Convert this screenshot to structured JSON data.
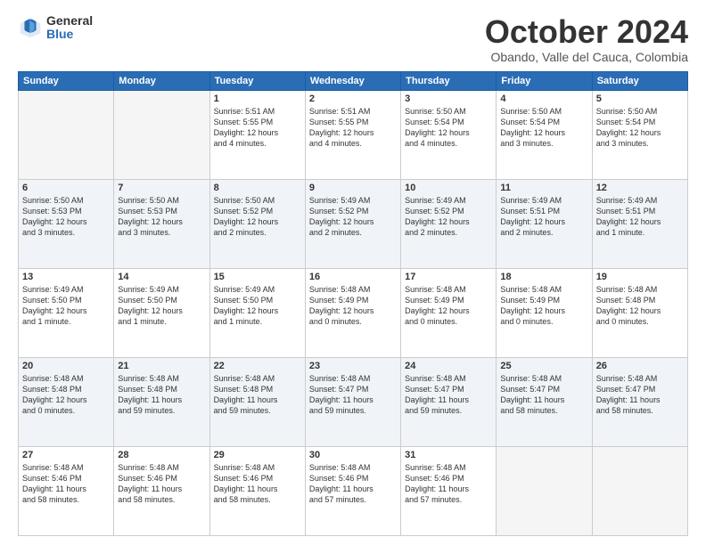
{
  "logo": {
    "general": "General",
    "blue": "Blue"
  },
  "header": {
    "month": "October 2024",
    "location": "Obando, Valle del Cauca, Colombia"
  },
  "days_of_week": [
    "Sunday",
    "Monday",
    "Tuesday",
    "Wednesday",
    "Thursday",
    "Friday",
    "Saturday"
  ],
  "weeks": [
    [
      {
        "day": "",
        "info": ""
      },
      {
        "day": "",
        "info": ""
      },
      {
        "day": "1",
        "info": "Sunrise: 5:51 AM\nSunset: 5:55 PM\nDaylight: 12 hours\nand 4 minutes."
      },
      {
        "day": "2",
        "info": "Sunrise: 5:51 AM\nSunset: 5:55 PM\nDaylight: 12 hours\nand 4 minutes."
      },
      {
        "day": "3",
        "info": "Sunrise: 5:50 AM\nSunset: 5:54 PM\nDaylight: 12 hours\nand 4 minutes."
      },
      {
        "day": "4",
        "info": "Sunrise: 5:50 AM\nSunset: 5:54 PM\nDaylight: 12 hours\nand 3 minutes."
      },
      {
        "day": "5",
        "info": "Sunrise: 5:50 AM\nSunset: 5:54 PM\nDaylight: 12 hours\nand 3 minutes."
      }
    ],
    [
      {
        "day": "6",
        "info": "Sunrise: 5:50 AM\nSunset: 5:53 PM\nDaylight: 12 hours\nand 3 minutes."
      },
      {
        "day": "7",
        "info": "Sunrise: 5:50 AM\nSunset: 5:53 PM\nDaylight: 12 hours\nand 3 minutes."
      },
      {
        "day": "8",
        "info": "Sunrise: 5:50 AM\nSunset: 5:52 PM\nDaylight: 12 hours\nand 2 minutes."
      },
      {
        "day": "9",
        "info": "Sunrise: 5:49 AM\nSunset: 5:52 PM\nDaylight: 12 hours\nand 2 minutes."
      },
      {
        "day": "10",
        "info": "Sunrise: 5:49 AM\nSunset: 5:52 PM\nDaylight: 12 hours\nand 2 minutes."
      },
      {
        "day": "11",
        "info": "Sunrise: 5:49 AM\nSunset: 5:51 PM\nDaylight: 12 hours\nand 2 minutes."
      },
      {
        "day": "12",
        "info": "Sunrise: 5:49 AM\nSunset: 5:51 PM\nDaylight: 12 hours\nand 1 minute."
      }
    ],
    [
      {
        "day": "13",
        "info": "Sunrise: 5:49 AM\nSunset: 5:50 PM\nDaylight: 12 hours\nand 1 minute."
      },
      {
        "day": "14",
        "info": "Sunrise: 5:49 AM\nSunset: 5:50 PM\nDaylight: 12 hours\nand 1 minute."
      },
      {
        "day": "15",
        "info": "Sunrise: 5:49 AM\nSunset: 5:50 PM\nDaylight: 12 hours\nand 1 minute."
      },
      {
        "day": "16",
        "info": "Sunrise: 5:48 AM\nSunset: 5:49 PM\nDaylight: 12 hours\nand 0 minutes."
      },
      {
        "day": "17",
        "info": "Sunrise: 5:48 AM\nSunset: 5:49 PM\nDaylight: 12 hours\nand 0 minutes."
      },
      {
        "day": "18",
        "info": "Sunrise: 5:48 AM\nSunset: 5:49 PM\nDaylight: 12 hours\nand 0 minutes."
      },
      {
        "day": "19",
        "info": "Sunrise: 5:48 AM\nSunset: 5:48 PM\nDaylight: 12 hours\nand 0 minutes."
      }
    ],
    [
      {
        "day": "20",
        "info": "Sunrise: 5:48 AM\nSunset: 5:48 PM\nDaylight: 12 hours\nand 0 minutes."
      },
      {
        "day": "21",
        "info": "Sunrise: 5:48 AM\nSunset: 5:48 PM\nDaylight: 11 hours\nand 59 minutes."
      },
      {
        "day": "22",
        "info": "Sunrise: 5:48 AM\nSunset: 5:48 PM\nDaylight: 11 hours\nand 59 minutes."
      },
      {
        "day": "23",
        "info": "Sunrise: 5:48 AM\nSunset: 5:47 PM\nDaylight: 11 hours\nand 59 minutes."
      },
      {
        "day": "24",
        "info": "Sunrise: 5:48 AM\nSunset: 5:47 PM\nDaylight: 11 hours\nand 59 minutes."
      },
      {
        "day": "25",
        "info": "Sunrise: 5:48 AM\nSunset: 5:47 PM\nDaylight: 11 hours\nand 58 minutes."
      },
      {
        "day": "26",
        "info": "Sunrise: 5:48 AM\nSunset: 5:47 PM\nDaylight: 11 hours\nand 58 minutes."
      }
    ],
    [
      {
        "day": "27",
        "info": "Sunrise: 5:48 AM\nSunset: 5:46 PM\nDaylight: 11 hours\nand 58 minutes."
      },
      {
        "day": "28",
        "info": "Sunrise: 5:48 AM\nSunset: 5:46 PM\nDaylight: 11 hours\nand 58 minutes."
      },
      {
        "day": "29",
        "info": "Sunrise: 5:48 AM\nSunset: 5:46 PM\nDaylight: 11 hours\nand 58 minutes."
      },
      {
        "day": "30",
        "info": "Sunrise: 5:48 AM\nSunset: 5:46 PM\nDaylight: 11 hours\nand 57 minutes."
      },
      {
        "day": "31",
        "info": "Sunrise: 5:48 AM\nSunset: 5:46 PM\nDaylight: 11 hours\nand 57 minutes."
      },
      {
        "day": "",
        "info": ""
      },
      {
        "day": "",
        "info": ""
      }
    ]
  ]
}
